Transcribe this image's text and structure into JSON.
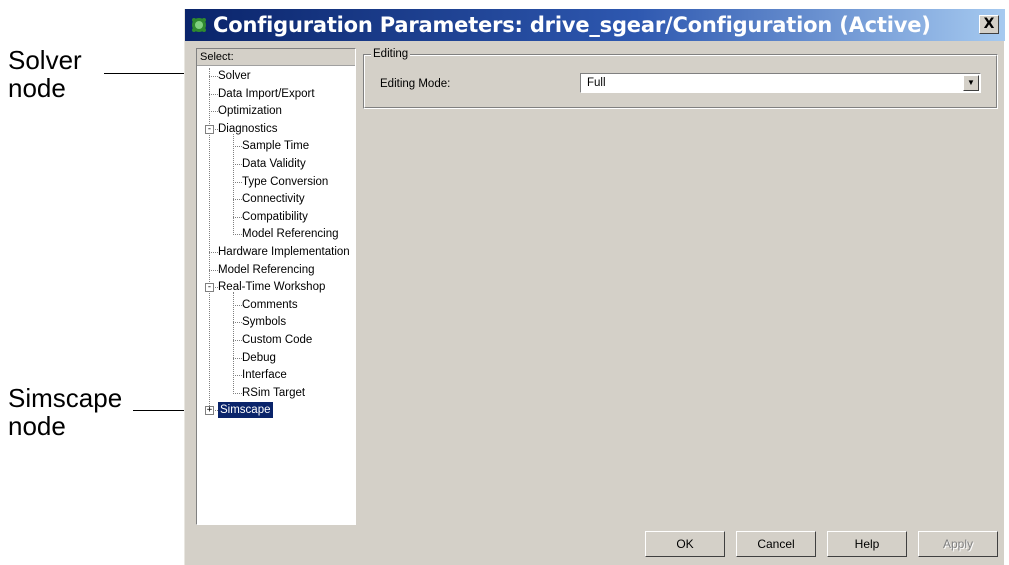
{
  "callouts": {
    "solver": [
      "Solver",
      "node"
    ],
    "simscape": [
      "Simscape",
      "node"
    ]
  },
  "dialog": {
    "title": "Configuration Parameters: drive_sgear/Configuration (Active)",
    "close_glyph": "X",
    "icon": "simulink-icon"
  },
  "tree": {
    "header": "Select:",
    "items": [
      {
        "label": "Solver",
        "level": 0,
        "expander": null
      },
      {
        "label": "Data Import/Export",
        "level": 0,
        "expander": null
      },
      {
        "label": "Optimization",
        "level": 0,
        "expander": null
      },
      {
        "label": "Diagnostics",
        "level": 0,
        "expander": "-"
      },
      {
        "label": "Sample Time",
        "level": 1,
        "expander": null
      },
      {
        "label": "Data Validity",
        "level": 1,
        "expander": null
      },
      {
        "label": "Type Conversion",
        "level": 1,
        "expander": null
      },
      {
        "label": "Connectivity",
        "level": 1,
        "expander": null
      },
      {
        "label": "Compatibility",
        "level": 1,
        "expander": null
      },
      {
        "label": "Model Referencing",
        "level": 1,
        "expander": null
      },
      {
        "label": "Hardware Implementation",
        "level": 0,
        "expander": null
      },
      {
        "label": "Model Referencing",
        "level": 0,
        "expander": null
      },
      {
        "label": "Real-Time Workshop",
        "level": 0,
        "expander": "-"
      },
      {
        "label": "Comments",
        "level": 1,
        "expander": null
      },
      {
        "label": "Symbols",
        "level": 1,
        "expander": null
      },
      {
        "label": "Custom Code",
        "level": 1,
        "expander": null
      },
      {
        "label": "Debug",
        "level": 1,
        "expander": null
      },
      {
        "label": "Interface",
        "level": 1,
        "expander": null
      },
      {
        "label": "RSim Target",
        "level": 1,
        "expander": null
      },
      {
        "label": "Simscape",
        "level": 0,
        "expander": "+",
        "selected": true
      }
    ]
  },
  "editing": {
    "group_label": "Editing",
    "mode_label": "Editing Mode:",
    "mode_value": "Full"
  },
  "buttons": {
    "ok": "OK",
    "cancel": "Cancel",
    "help": "Help",
    "apply": "Apply"
  },
  "colors": {
    "title_bar_start": "#0a246a",
    "title_bar_end": "#a6caf0",
    "dialog_face": "#d4d0c8",
    "selection": "#0a246a"
  }
}
